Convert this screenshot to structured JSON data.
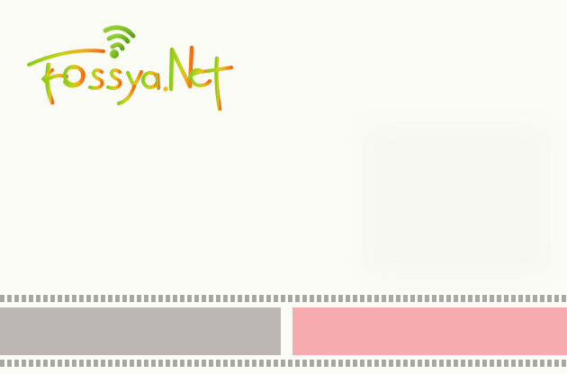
{
  "logo": {
    "text": "Fossya.Net",
    "icon": "wifi-signal-icon",
    "colors": {
      "gradient_start": "#8ccc1a",
      "gradient_mid": "#f0b21a",
      "gradient_end": "#f36a12",
      "icon": "#7ecb1f"
    }
  },
  "colors": {
    "background": "#fbfcf6",
    "film_perforation": "#a8a8a5",
    "left_frame": "#bcb7b5",
    "right_frame": "#f8abaf"
  }
}
